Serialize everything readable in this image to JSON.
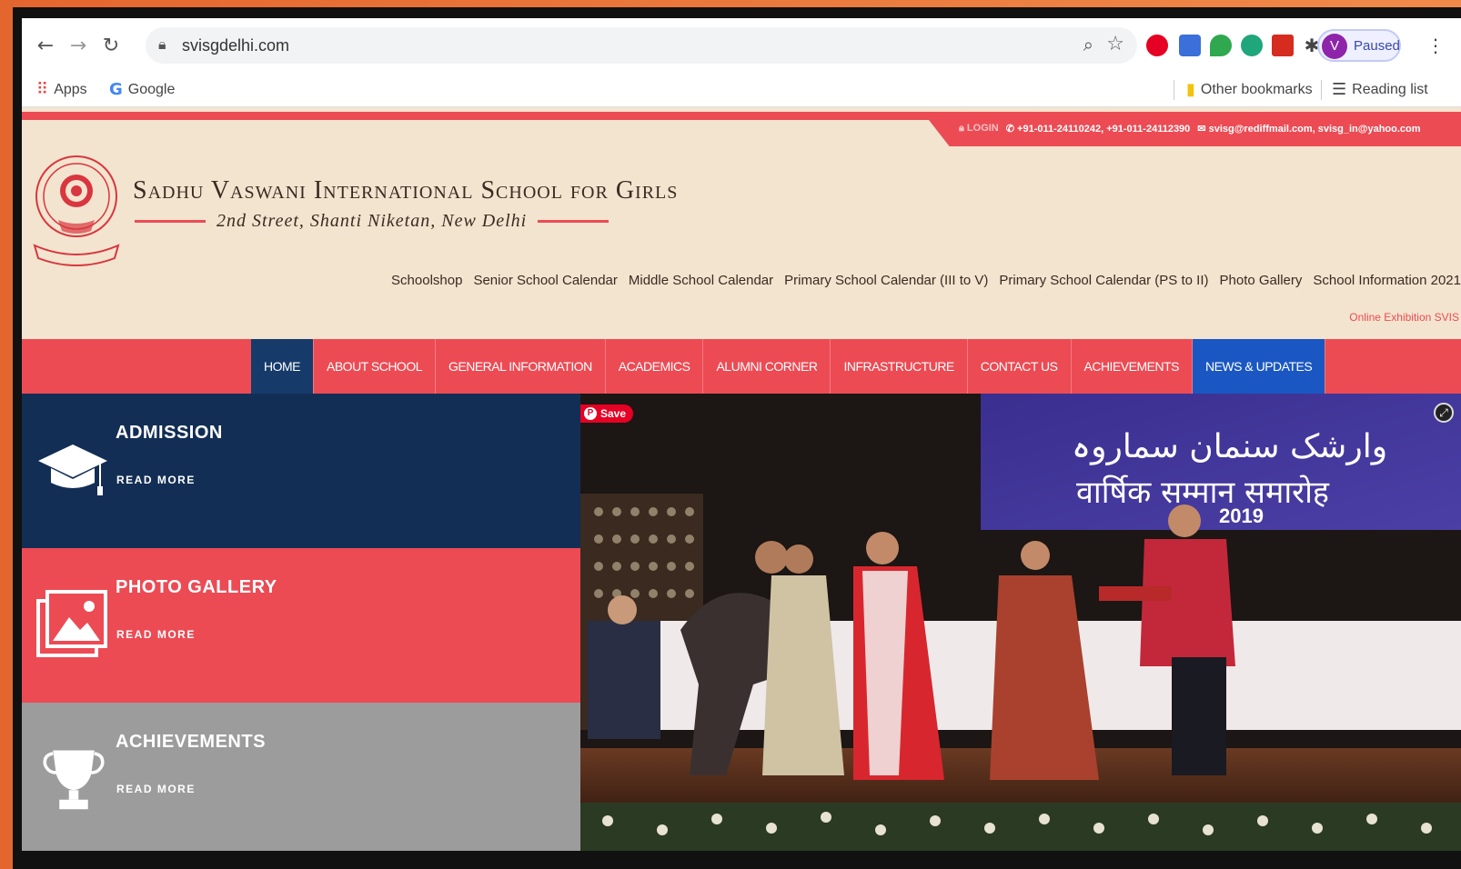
{
  "browser": {
    "url": "svisgdelhi.com",
    "profile_initial": "V",
    "profile_status": "Paused",
    "bookmarks": {
      "apps": "Apps",
      "google": "Google",
      "other": "Other bookmarks",
      "reading": "Reading list"
    }
  },
  "site": {
    "topbar": {
      "login": "LOGIN",
      "phones": "+91-011-24110242, +91-011-24112390",
      "emails": "svisg@rediffmail.com, svisg_in@yahoo.com"
    },
    "school_name": "Sadhu Vaswani International School for Girls",
    "address": "2nd Street, Shanti Niketan, New Delhi",
    "sublinks": [
      "Schoolshop",
      "Senior School Calendar",
      "Middle School Calendar",
      "Primary School Calendar (III to V)",
      "Primary School Calendar (PS to II)",
      "Photo Gallery",
      "School Information 2021"
    ],
    "online_exhibition": "Online Exhibition SVIS",
    "nav": [
      "HOME",
      "ABOUT SCHOOL",
      "GENERAL INFORMATION",
      "ACADEMICS",
      "ALUMNI CORNER",
      "INFRASTRUCTURE",
      "CONTACT US",
      "ACHIEVEMENTS",
      "NEWS & UPDATES"
    ],
    "tiles": [
      {
        "title": "ADMISSION",
        "more": "READ MORE"
      },
      {
        "title": "PHOTO GALLERY",
        "more": "READ MORE"
      },
      {
        "title": "ACHIEVEMENTS",
        "more": "READ MORE"
      }
    ],
    "photo": {
      "save_label": "Save",
      "banner_urdu": "وارشک سنمان سماروہ",
      "banner_hindi": "वार्षिक सम्मान समारोह",
      "banner_year": "2019"
    }
  },
  "colors": {
    "accent_red": "#ec4b54",
    "navy": "#132e55",
    "cream": "#f3e4cf",
    "news_blue": "#1a57c2"
  }
}
